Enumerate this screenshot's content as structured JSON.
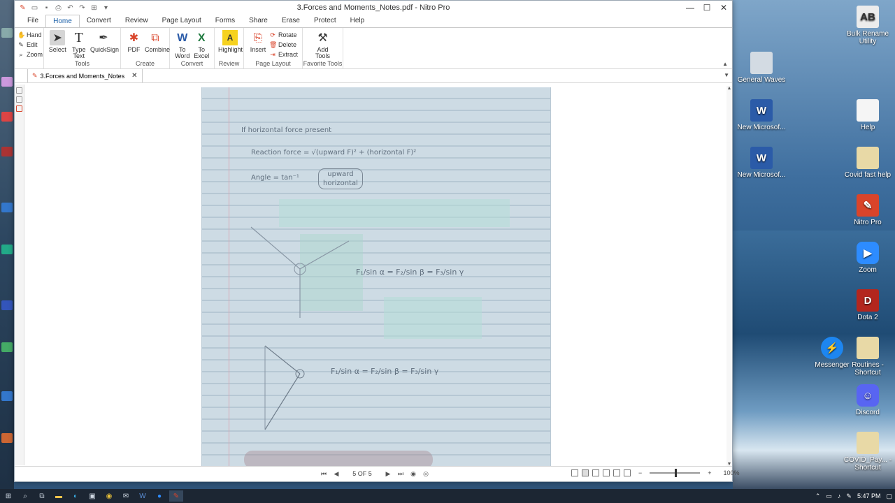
{
  "window": {
    "title": "3.Forces and Moments_Notes.pdf - Nitro Pro",
    "controls": {
      "minimize": "—",
      "maximize": "☐",
      "close": "✕"
    }
  },
  "menu_tabs": [
    "File",
    "Home",
    "Convert",
    "Review",
    "Page Layout",
    "Forms",
    "Share",
    "Erase",
    "Protect",
    "Help"
  ],
  "ribbon": {
    "nav": {
      "hand": "Hand",
      "edit": "Edit",
      "zoom": "Zoom"
    },
    "tools": {
      "select": "Select",
      "type_text_1": "Type",
      "type_text_2": "Text",
      "quicksign": "QuickSign",
      "label": "Tools"
    },
    "create": {
      "pdf": "PDF",
      "combine": "Combine",
      "label": "Create"
    },
    "convert": {
      "to_word_1": "To",
      "to_word_2": "Word",
      "to_excel_1": "To",
      "to_excel_2": "Excel",
      "label": "Convert"
    },
    "review": {
      "highlight": "Highlight",
      "label": "Review"
    },
    "page_layout": {
      "insert": "Insert",
      "rotate": "Rotate",
      "delete": "Delete",
      "extract": "Extract",
      "label": "Page Layout"
    },
    "favorite": {
      "add_tools_1": "Add",
      "add_tools_2": "Tools",
      "label": "Favorite Tools"
    }
  },
  "doc_tab": {
    "name": "3.Forces and Moments_Notes",
    "close": "✕"
  },
  "notes": {
    "line1": "If horizontal force present",
    "line2": "Reaction force = √(upward F)² + (horizontal F)²",
    "line3a": "Angle = tan⁻¹",
    "line3b": "upward",
    "line3c": "horizontal",
    "eq1": "F₁/sin α = F₂/sin β = F₃/sin γ",
    "eq2": "F₁/sin α = F₂/sin β = F₃/sin γ"
  },
  "status": {
    "page_indicator": "5 OF 5",
    "zoom": "100%",
    "zoom_fraction": 0.5
  },
  "desktop_icons": [
    {
      "label": "Bulk Rename Utility",
      "color": "#e8e8e8"
    },
    {
      "label": "General Waves",
      "color": "#c8d2dc"
    },
    {
      "label": "Help",
      "color": "#f2f2f2"
    },
    {
      "label": "New Microsof...",
      "color": "#2b5ba8"
    },
    {
      "label": "Covid fast help",
      "color": "#e8d9a6"
    },
    {
      "label": "New Microsof...",
      "color": "#2b5ba8"
    },
    {
      "label": "Nitro Pro",
      "color": "#d9442a"
    },
    {
      "label": "Zoom",
      "color": "#2d8cff"
    },
    {
      "label": "Dota 2",
      "color": "#b3261e"
    },
    {
      "label": "Messenger",
      "color": "#1d86f0"
    },
    {
      "label": "Routines - Shortcut",
      "color": "#e8d9a6"
    },
    {
      "label": "Discord",
      "color": "#5865f2"
    },
    {
      "label": "COVID_Pay... - Shortcut",
      "color": "#e8d9a6"
    }
  ],
  "taskbar": {
    "time": "5:47 PM"
  }
}
